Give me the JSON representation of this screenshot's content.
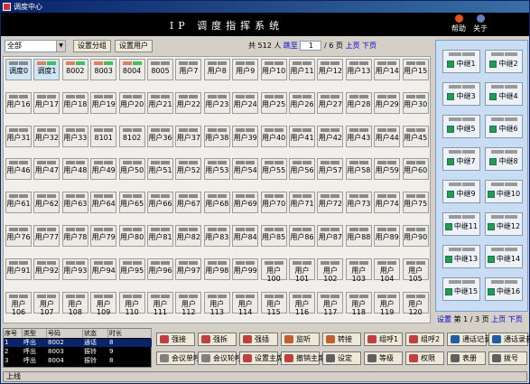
{
  "window": {
    "title": "调度中心"
  },
  "header": {
    "app_title": "IP 调度指挥系统",
    "help_label": "帮助",
    "about_label": "关于"
  },
  "toolbar": {
    "group_value": "全部",
    "set_group_label": "设置分组",
    "set_user_label": "设置用户"
  },
  "pager": {
    "total_prefix": "共",
    "total": "512",
    "total_suffix": "人",
    "jump_label": "跳至",
    "page_value": "1",
    "page_sep": "/",
    "page_total": "6",
    "page_suffix": "页",
    "prev_label": "上页",
    "next_label": "下页"
  },
  "users": [
    "调度0",
    "调度1",
    "8002",
    "8003",
    "8004",
    "8005",
    "用户7",
    "用户8",
    "用户9",
    "用户10",
    "用户11",
    "用户12",
    "用户13",
    "用户14",
    "用户15",
    "用户16",
    "用户17",
    "用户18",
    "用户19",
    "用户20",
    "用户21",
    "用户22",
    "用户23",
    "用户24",
    "用户25",
    "用户26",
    "用户27",
    "用户28",
    "用户29",
    "用户30",
    "用户31",
    "用户32",
    "用户33",
    "8101",
    "8102",
    "用户36",
    "用户37",
    "用户38",
    "用户39",
    "用户40",
    "用户41",
    "用户42",
    "用户43",
    "用户44",
    "用户45",
    "用户46",
    "用户47",
    "用户48",
    "用户49",
    "用户50",
    "用户51",
    "用户52",
    "用户53",
    "用户54",
    "用户55",
    "用户56",
    "用户57",
    "用户58",
    "用户59",
    "用户60",
    "用户61",
    "用户62",
    "用户63",
    "用户64",
    "用户65",
    "用户66",
    "用户67",
    "用户68",
    "用户69",
    "用户70",
    "用户71",
    "用户72",
    "用户73",
    "用户74",
    "用户75",
    "用户76",
    "用户77",
    "用户78",
    "用户79",
    "用户80",
    "用户81",
    "用户82",
    "用户83",
    "用户84",
    "用户85",
    "用户86",
    "用户87",
    "用户88",
    "用户89",
    "用户90",
    "用户91",
    "用户92",
    "用户93",
    "用户94",
    "用户95",
    "用户96",
    "用户97",
    "用户98",
    "用户99",
    "用户100",
    "用户101",
    "用户102",
    "用户103",
    "用户104",
    "用户105",
    "用户106",
    "用户107",
    "用户108",
    "用户109",
    "用户110",
    "用户111",
    "用户112",
    "用户113",
    "用户114",
    "用户115",
    "用户116",
    "用户117",
    "用户118",
    "用户119",
    "用户120"
  ],
  "user_status_colors": [
    "#e08060",
    "#e08060",
    "#e08060",
    "#e08060",
    "#e08060"
  ],
  "user_status_colors_right": [
    "#40c060",
    "#40c060",
    "#40c060",
    "#40c060",
    "#40c060"
  ],
  "trunks": [
    "中继1",
    "中继2",
    "中继3",
    "中继4",
    "中继5",
    "中继6",
    "中继7",
    "中继8",
    "中继9",
    "中继10",
    "中继11",
    "中继12",
    "中继13",
    "中继14",
    "中继15",
    "中继16"
  ],
  "trunk_pager": {
    "set_label": "设置",
    "page_label": "第",
    "page_value": "1",
    "page_sep": "/",
    "page_total": "3",
    "page_suffix": "页",
    "prev_label": "上页",
    "next_label": "下页"
  },
  "calls": {
    "headers": [
      "序号",
      "类型",
      "号码",
      "状态",
      "时长"
    ],
    "rows": [
      [
        "1",
        "呼出",
        "8002",
        "通话",
        "8"
      ],
      [
        "2",
        "呼出",
        "8003",
        "振铃",
        "9"
      ],
      [
        "3",
        "呼出",
        "8004",
        "振铃",
        "8"
      ]
    ]
  },
  "actions": [
    {
      "label": "强接",
      "icon": "force-answer-icon",
      "color": "#c04040"
    },
    {
      "label": "强拆",
      "icon": "force-release-icon",
      "color": "#c04040"
    },
    {
      "label": "强插",
      "icon": "force-insert-icon",
      "color": "#c04040"
    },
    {
      "label": "监听",
      "icon": "monitor-icon",
      "color": "#c06030"
    },
    {
      "label": "转接",
      "icon": "transfer-icon",
      "color": "#c06030"
    },
    {
      "label": "组呼1",
      "icon": "group-call-icon",
      "color": "#c04040"
    },
    {
      "label": "组呼2",
      "icon": "group-call-icon",
      "color": "#c04040"
    },
    {
      "label": "通话记录",
      "icon": "call-log-icon",
      "color": "#2060a0"
    },
    {
      "label": "通话录音",
      "icon": "recording-icon",
      "color": "#2060a0"
    },
    {
      "label": "会议单呼",
      "icon": "conference-icon",
      "color": "#808080"
    },
    {
      "label": "会议轮呼",
      "icon": "conference-icon",
      "color": "#808080"
    },
    {
      "label": "设置主席",
      "icon": "chairman-icon",
      "color": "#c04040"
    },
    {
      "label": "撤销主席",
      "icon": "revoke-icon",
      "color": "#c04040"
    },
    {
      "label": "设定",
      "icon": "settings-icon",
      "color": "#606060"
    },
    {
      "label": "等级",
      "icon": "level-icon",
      "color": "#606060"
    },
    {
      "label": "权限",
      "icon": "permission-icon",
      "color": "#c04040"
    },
    {
      "label": "表册",
      "icon": "roster-icon",
      "color": "#606060"
    },
    {
      "label": "拨号",
      "icon": "dial-icon",
      "color": "#606060"
    }
  ],
  "status": {
    "text": "上线"
  }
}
